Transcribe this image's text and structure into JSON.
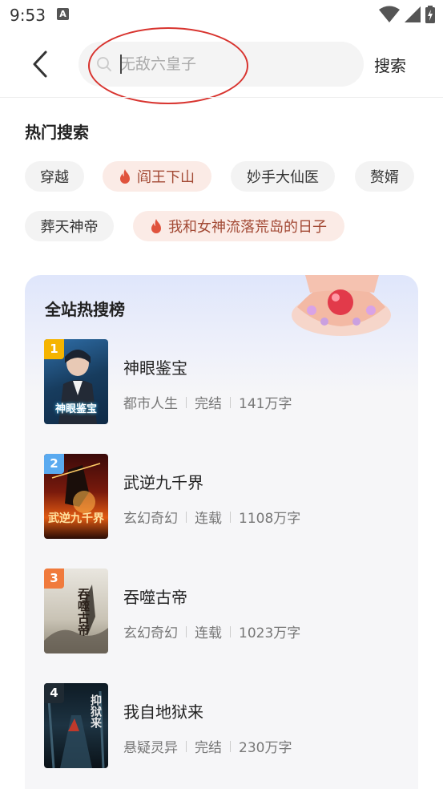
{
  "status_bar": {
    "time": "9:53",
    "notification_icon_letter": "A",
    "icons": [
      "wifi-icon",
      "signal-icon",
      "battery-charging-icon"
    ]
  },
  "search": {
    "back_icon": "chevron-left-icon",
    "search_icon": "magnifier-icon",
    "placeholder": "无敌六皇子",
    "button_label": "搜索"
  },
  "hot_search": {
    "title": "热门搜索",
    "tags": [
      {
        "label": "穿越",
        "hot": false
      },
      {
        "label": "阎王下山",
        "hot": true
      },
      {
        "label": "妙手大仙医",
        "hot": false
      },
      {
        "label": "赘婿",
        "hot": false
      },
      {
        "label": "葬天神帝",
        "hot": false
      },
      {
        "label": "我和女神流落荒岛的日子",
        "hot": true
      }
    ]
  },
  "ranking": {
    "title": "全站热搜榜",
    "books": [
      {
        "rank": "1",
        "cover_text": "神眼鉴宝",
        "name": "神眼鉴宝",
        "genre": "都市人生",
        "status": "完结",
        "words": "141万字",
        "rank_color": "#f5b400"
      },
      {
        "rank": "2",
        "cover_text": "武逆九千界",
        "name": "武逆九千界",
        "genre": "玄幻奇幻",
        "status": "连载",
        "words": "1108万字",
        "rank_color": "#5aaaf0"
      },
      {
        "rank": "3",
        "cover_text": "吞噬古帝",
        "name": "吞噬古帝",
        "genre": "玄幻奇幻",
        "status": "连载",
        "words": "1023万字",
        "rank_color": "#f07a3c"
      },
      {
        "rank": "4",
        "cover_text": "抑狱来",
        "name": "我自地狱来",
        "genre": "悬疑灵异",
        "status": "完结",
        "words": "230万字",
        "rank_color": "#1f2a33"
      }
    ]
  },
  "colors": {
    "hot_tag_bg": "#fbebe6",
    "hot_tag_text": "#a34a35",
    "annotation_ellipse": "#d8342f"
  }
}
